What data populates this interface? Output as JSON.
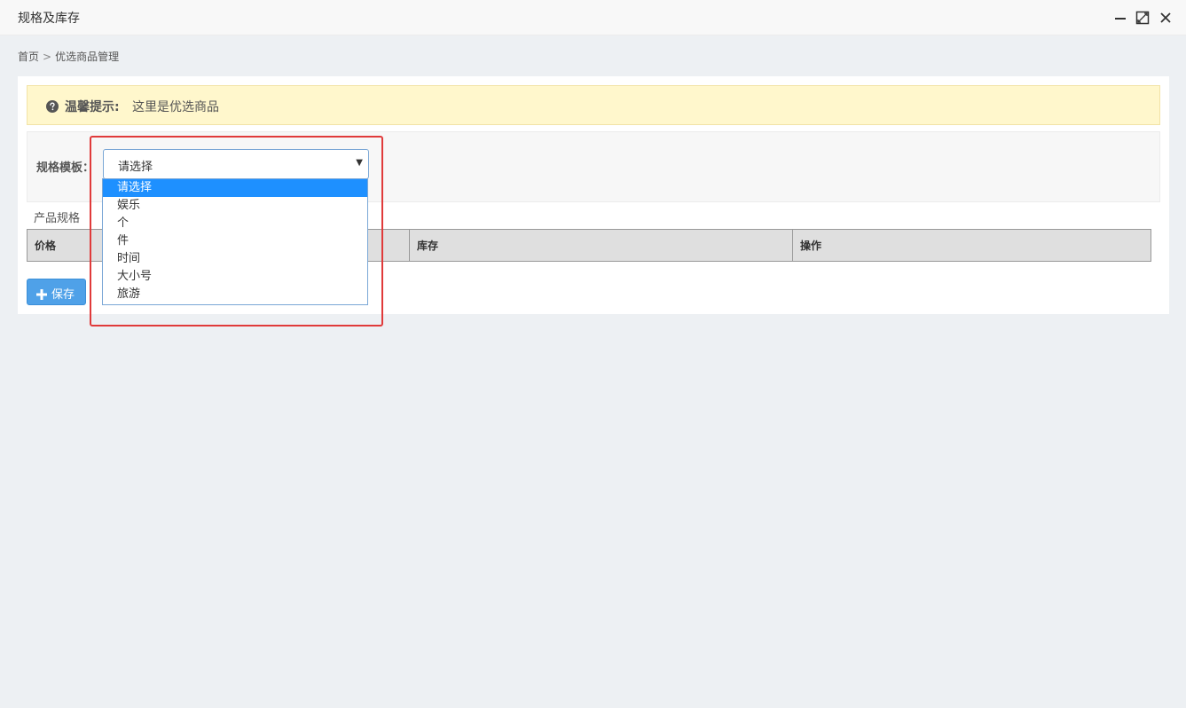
{
  "window": {
    "title": "规格及库存",
    "controls": [
      "minimize-icon",
      "maximize-icon",
      "close-icon"
    ]
  },
  "breadcrumb": {
    "home": "首页",
    "separator": ">",
    "current": "优选商品管理"
  },
  "tip": {
    "icon": "question-circle-icon",
    "label": "温馨提示:",
    "text": "这里是优选商品"
  },
  "form": {
    "template_label": "规格模板：",
    "select_value": "请选择",
    "options": [
      "请选择",
      "娱乐",
      "个",
      "件",
      "时间",
      "大小号",
      "旅游"
    ],
    "selected_index": 0
  },
  "spec": {
    "section_title": "产品规格",
    "columns": [
      "价格",
      "库存",
      "操作"
    ]
  },
  "actions": {
    "save_icon": "plus-icon",
    "save_label": "保存"
  },
  "colors": {
    "accent": "#4fa1e8",
    "selected_option": "#1e90ff",
    "tip_background": "#fff7cc",
    "highlight_border": "#e03a3a"
  }
}
